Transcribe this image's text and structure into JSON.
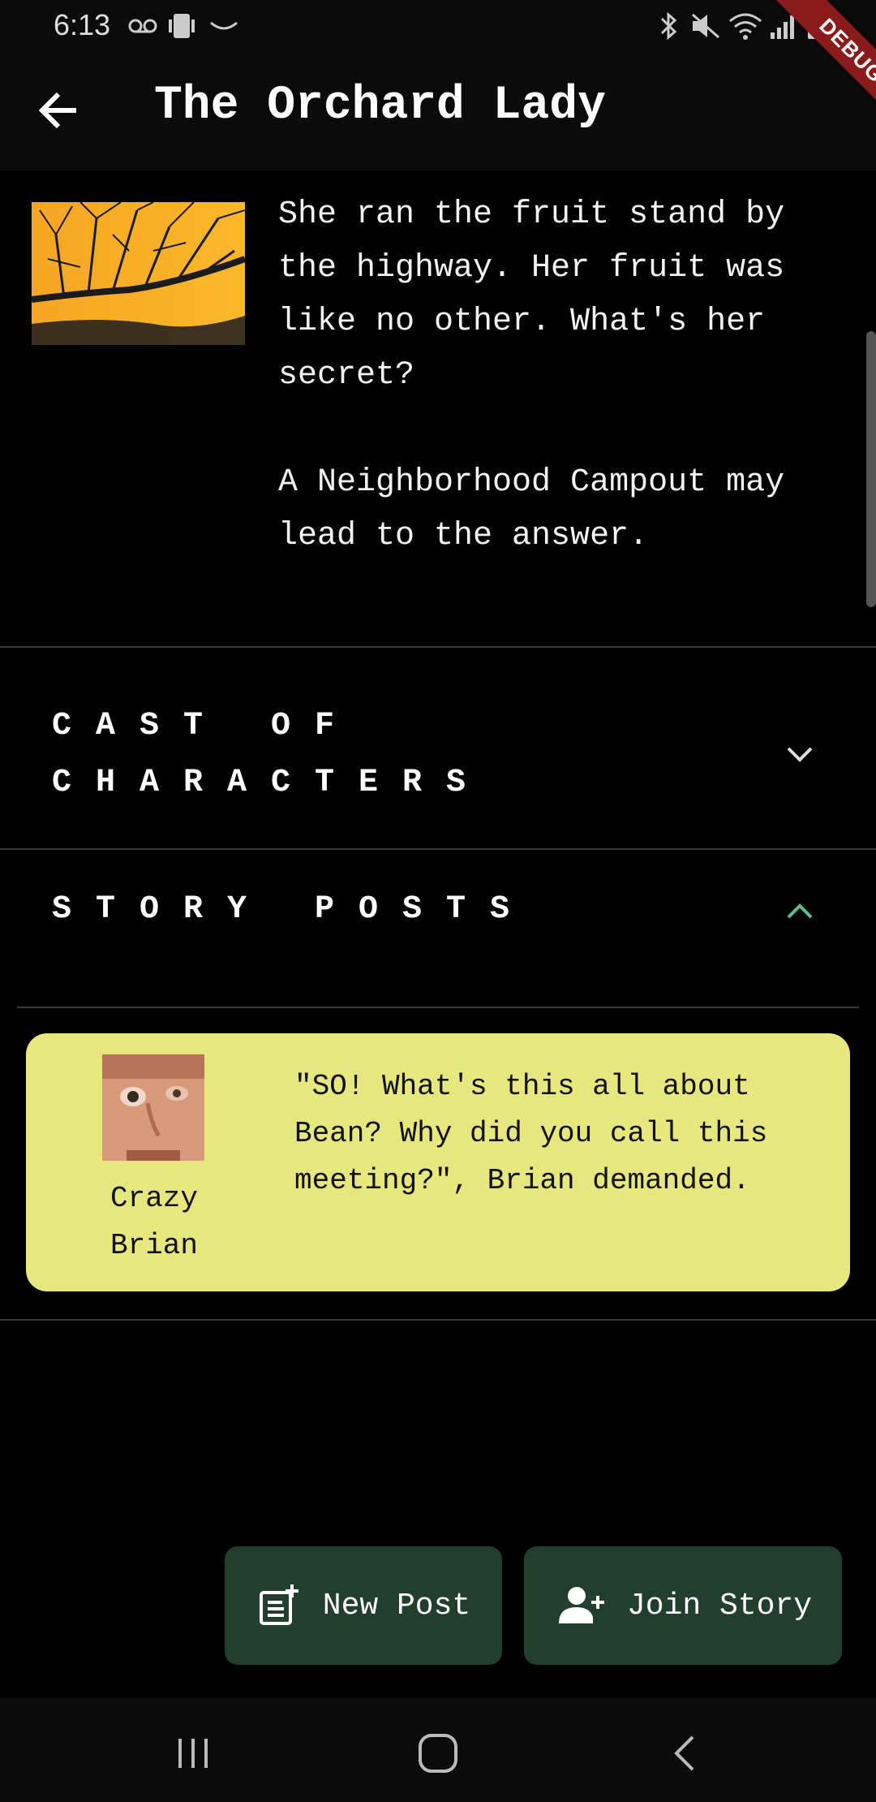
{
  "status_bar": {
    "time": "6:13"
  },
  "debug_banner": "DEBUG",
  "app_bar": {
    "title": "The Orchard Lady"
  },
  "story": {
    "description": "She ran the fruit stand by the highway. Her fruit was like no other. What's her secret?\n\nA Neighborhood Campout may lead to the answer."
  },
  "sections": {
    "cast": "CAST OF CHARACTERS",
    "posts": "STORY POSTS"
  },
  "post": {
    "author": "Crazy\nBrian",
    "text": "\"SO! What's this all about Bean? Why did you call this meeting?\", Brian demanded."
  },
  "actions": {
    "new_post": "New Post",
    "join_story": "Join Story"
  },
  "colors": {
    "card": "#e6e77c",
    "button": "#213f2c",
    "accent": "#5fbf8a"
  }
}
